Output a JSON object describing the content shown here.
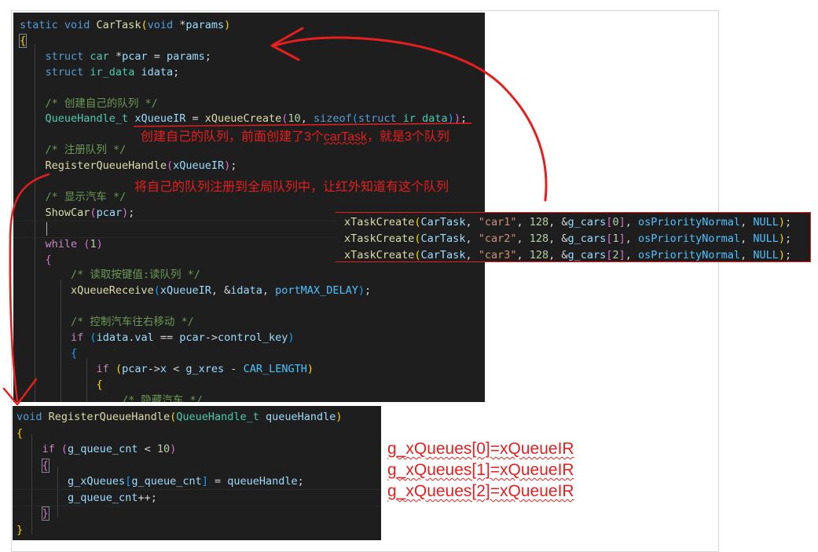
{
  "car_task": {
    "lines": [
      {
        "parts": [
          [
            "kw",
            "static "
          ],
          [
            "kw",
            "void "
          ],
          [
            "fn",
            "CarTask"
          ],
          [
            "brY",
            "("
          ],
          [
            "kw",
            "void "
          ],
          [
            "pun",
            "*"
          ],
          [
            "var",
            "params"
          ],
          [
            "brY",
            ")"
          ]
        ]
      },
      {
        "parts": [
          [
            "brY boxed",
            "{"
          ]
        ]
      },
      {
        "parts": [
          [
            "pun",
            "    "
          ],
          [
            "kw",
            "struct "
          ],
          [
            "ty",
            "car "
          ],
          [
            "pun",
            "*"
          ],
          [
            "var",
            "pcar"
          ],
          [
            "pun",
            " = "
          ],
          [
            "var",
            "params"
          ],
          [
            "pun",
            ";"
          ]
        ]
      },
      {
        "parts": [
          [
            "pun",
            "    "
          ],
          [
            "kw",
            "struct "
          ],
          [
            "ty",
            "ir_data "
          ],
          [
            "var",
            "idata"
          ],
          [
            "pun",
            ";"
          ]
        ]
      },
      {
        "parts": []
      },
      {
        "parts": [
          [
            "pun",
            "    "
          ],
          [
            "cmt",
            "/* 创建自己的队列 */"
          ]
        ]
      },
      {
        "parts": [
          [
            "pun",
            "    "
          ],
          [
            "ty",
            "QueueHandle_t "
          ],
          [
            "var",
            "xQueueIR"
          ],
          [
            "pun",
            " = "
          ],
          [
            "fn",
            "xQueueCreate"
          ],
          [
            "brP",
            "("
          ],
          [
            "num",
            "10"
          ],
          [
            "pun",
            ", "
          ],
          [
            "kw",
            "sizeof"
          ],
          [
            "brB",
            "("
          ],
          [
            "kw",
            "struct "
          ],
          [
            "ty",
            "ir_data"
          ],
          [
            "brB",
            ")"
          ],
          [
            "brP",
            ")"
          ],
          [
            "pun",
            ";"
          ]
        ]
      },
      {
        "parts": []
      },
      {
        "parts": [
          [
            "pun",
            "    "
          ],
          [
            "cmt",
            "/* 注册队列 */"
          ]
        ]
      },
      {
        "parts": [
          [
            "pun",
            "    "
          ],
          [
            "fn",
            "RegisterQueueHandle"
          ],
          [
            "brP",
            "("
          ],
          [
            "var",
            "xQueueIR"
          ],
          [
            "brP",
            ")"
          ],
          [
            "pun",
            ";"
          ]
        ]
      },
      {
        "parts": []
      },
      {
        "parts": [
          [
            "pun",
            "    "
          ],
          [
            "cmt",
            "/* 显示汽车 */"
          ]
        ]
      },
      {
        "parts": [
          [
            "pun",
            "    "
          ],
          [
            "fn",
            "ShowCar"
          ],
          [
            "brP",
            "("
          ],
          [
            "var",
            "pcar"
          ],
          [
            "brP",
            ")"
          ],
          [
            "pun",
            ";"
          ]
        ]
      },
      {
        "parts": []
      },
      {
        "parts": [
          [
            "pun",
            "    "
          ],
          [
            "ctl",
            "while "
          ],
          [
            "brP",
            "("
          ],
          [
            "num",
            "1"
          ],
          [
            "brP",
            ")"
          ]
        ]
      },
      {
        "parts": [
          [
            "pun",
            "    "
          ],
          [
            "brP",
            "{"
          ]
        ]
      },
      {
        "parts": [
          [
            "pun",
            "        "
          ],
          [
            "cmt",
            "/* 读取按键值:读队列 */"
          ]
        ]
      },
      {
        "parts": [
          [
            "pun",
            "        "
          ],
          [
            "fn",
            "xQueueReceive"
          ],
          [
            "brB",
            "("
          ],
          [
            "var",
            "xQueueIR"
          ],
          [
            "pun",
            ", &"
          ],
          [
            "var",
            "idata"
          ],
          [
            "pun",
            ", "
          ],
          [
            "mac",
            "portMAX_DELAY"
          ],
          [
            "brB",
            ")"
          ],
          [
            "pun",
            ";"
          ]
        ]
      },
      {
        "parts": []
      },
      {
        "parts": [
          [
            "pun",
            "        "
          ],
          [
            "cmt",
            "/* 控制汽车往右移动 */"
          ]
        ]
      },
      {
        "parts": [
          [
            "pun",
            "        "
          ],
          [
            "ctl",
            "if "
          ],
          [
            "brB",
            "("
          ],
          [
            "var",
            "idata"
          ],
          [
            "pun",
            "."
          ],
          [
            "var",
            "val"
          ],
          [
            "pun",
            " == "
          ],
          [
            "var",
            "pcar"
          ],
          [
            "pun",
            "->"
          ],
          [
            "var",
            "control_key"
          ],
          [
            "brB",
            ")"
          ]
        ]
      },
      {
        "parts": [
          [
            "pun",
            "        "
          ],
          [
            "brB",
            "{"
          ]
        ]
      },
      {
        "parts": [
          [
            "pun",
            "            "
          ],
          [
            "ctl",
            "if "
          ],
          [
            "brY",
            "("
          ],
          [
            "var",
            "pcar"
          ],
          [
            "pun",
            "->"
          ],
          [
            "var",
            "x"
          ],
          [
            "pun",
            " < "
          ],
          [
            "var",
            "g_xres"
          ],
          [
            "pun",
            " - "
          ],
          [
            "mac",
            "CAR_LENGTH"
          ],
          [
            "brY",
            ")"
          ]
        ]
      },
      {
        "parts": [
          [
            "pun",
            "            "
          ],
          [
            "brY",
            "{"
          ]
        ]
      },
      {
        "parts": [
          [
            "pun",
            "                "
          ],
          [
            "cmt",
            "/* 隐藏汽车 */"
          ]
        ]
      }
    ]
  },
  "task_create": {
    "lines": [
      {
        "parts": [
          [
            "fn",
            "xTaskCreate"
          ],
          [
            "brY",
            "("
          ],
          [
            "var",
            "CarTask"
          ],
          [
            "pun",
            ", "
          ],
          [
            "str",
            "\"car1\""
          ],
          [
            "pun",
            ", "
          ],
          [
            "num",
            "128"
          ],
          [
            "pun",
            ", &"
          ],
          [
            "var",
            "g_cars"
          ],
          [
            "brP",
            "["
          ],
          [
            "num",
            "0"
          ],
          [
            "brP",
            "]"
          ],
          [
            "pun",
            ", "
          ],
          [
            "mac",
            "osPriorityNormal"
          ],
          [
            "pun",
            ", "
          ],
          [
            "mac",
            "NULL"
          ],
          [
            "brY",
            ")"
          ],
          [
            "pun",
            ";"
          ]
        ]
      },
      {
        "parts": [
          [
            "fn",
            "xTaskCreate"
          ],
          [
            "brY",
            "("
          ],
          [
            "var",
            "CarTask"
          ],
          [
            "pun",
            ", "
          ],
          [
            "str",
            "\"car2\""
          ],
          [
            "pun",
            ", "
          ],
          [
            "num",
            "128"
          ],
          [
            "pun",
            ", &"
          ],
          [
            "var",
            "g_cars"
          ],
          [
            "brP",
            "["
          ],
          [
            "num",
            "1"
          ],
          [
            "brP",
            "]"
          ],
          [
            "pun",
            ", "
          ],
          [
            "mac",
            "osPriorityNormal"
          ],
          [
            "pun",
            ", "
          ],
          [
            "mac",
            "NULL"
          ],
          [
            "brY",
            ")"
          ],
          [
            "pun",
            ";"
          ]
        ]
      },
      {
        "parts": [
          [
            "fn",
            "xTaskCreate"
          ],
          [
            "brY",
            "("
          ],
          [
            "var",
            "CarTask"
          ],
          [
            "pun",
            ", "
          ],
          [
            "str",
            "\"car3\""
          ],
          [
            "pun",
            ", "
          ],
          [
            "num",
            "128"
          ],
          [
            "pun",
            ", &"
          ],
          [
            "var",
            "g_cars"
          ],
          [
            "brP",
            "["
          ],
          [
            "num",
            "2"
          ],
          [
            "brP",
            "]"
          ],
          [
            "pun",
            ", "
          ],
          [
            "mac",
            "osPriorityNormal"
          ],
          [
            "pun",
            ", "
          ],
          [
            "mac",
            "NULL"
          ],
          [
            "brY",
            ")"
          ],
          [
            "pun",
            ";"
          ]
        ]
      }
    ]
  },
  "register_fn": {
    "lines": [
      {
        "parts": [
          [
            "kw",
            "void "
          ],
          [
            "fn",
            "RegisterQueueHandle"
          ],
          [
            "brY",
            "("
          ],
          [
            "ty",
            "QueueHandle_t "
          ],
          [
            "var",
            "queueHandle"
          ],
          [
            "brY",
            ")"
          ]
        ]
      },
      {
        "parts": [
          [
            "brY",
            "{"
          ]
        ]
      },
      {
        "parts": [
          [
            "pun",
            "    "
          ],
          [
            "ctl",
            "if "
          ],
          [
            "brP",
            "("
          ],
          [
            "var",
            "g_queue_cnt"
          ],
          [
            "pun",
            " < "
          ],
          [
            "num",
            "10"
          ],
          [
            "brP",
            ")"
          ]
        ]
      },
      {
        "parts": [
          [
            "pun",
            "    "
          ],
          [
            "brP boxed",
            "{"
          ]
        ]
      },
      {
        "parts": [
          [
            "pun",
            "        "
          ],
          [
            "var",
            "g_xQueues"
          ],
          [
            "brB",
            "["
          ],
          [
            "var",
            "g_queue_cnt"
          ],
          [
            "brB",
            "]"
          ],
          [
            "pun",
            " = "
          ],
          [
            "var",
            "queueHandle"
          ],
          [
            "pun",
            ";"
          ]
        ]
      },
      {
        "parts": [
          [
            "pun",
            "        "
          ],
          [
            "var",
            "g_queue_cnt"
          ],
          [
            "pun",
            "++;"
          ]
        ]
      },
      {
        "parts": [
          [
            "pun",
            "    "
          ],
          [
            "brP boxed",
            "}"
          ]
        ]
      },
      {
        "parts": [
          [
            "brY",
            "}"
          ]
        ]
      }
    ]
  },
  "annotations": {
    "note1_prefix": "创建自己的队列，前面创建了3个",
    "note1_underlined": "carTask",
    "note1_suffix": "，就是3个队列",
    "note2": "将自己的队列注册到全局队列中，让红外知道有这个队列"
  },
  "queue_notes": [
    "g_xQueues[0]=xQueueIR",
    "g_xQueues[1]=xQueueIR",
    "g_xQueues[2]=xQueueIR"
  ],
  "colors": {
    "annotation": "#e51e1e",
    "editor_bg": "#1e1e1e"
  }
}
